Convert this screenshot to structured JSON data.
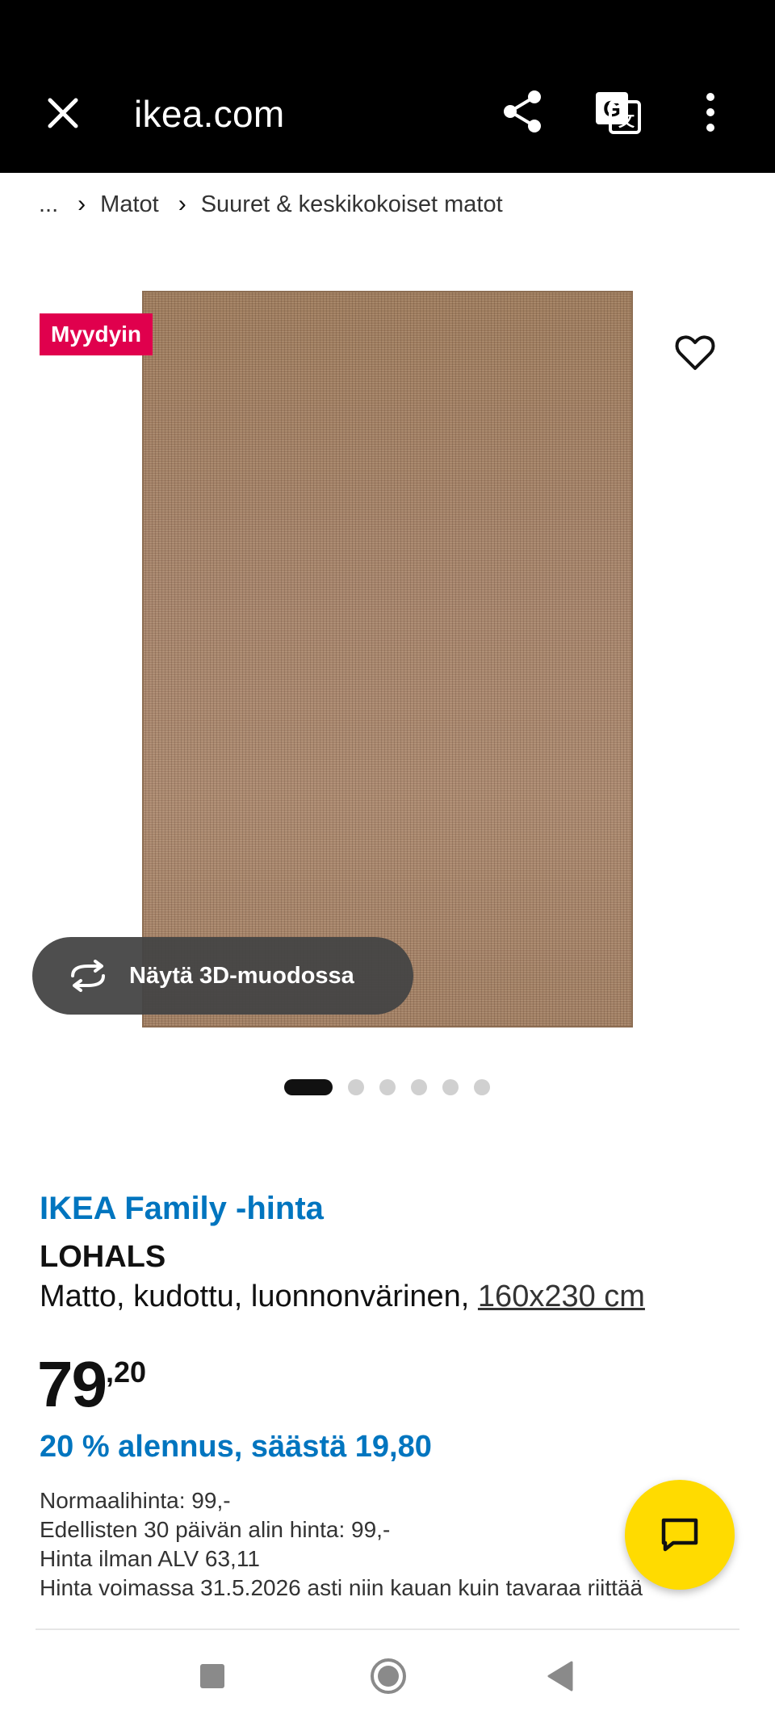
{
  "browser": {
    "domain": "ikea.com",
    "icons": [
      "close-icon",
      "share-icon",
      "translate-icon",
      "more-vert-icon"
    ]
  },
  "breadcrumb": [
    "...",
    "Matot",
    "Suuret & keskikokoiset matot"
  ],
  "gallery": {
    "badge": "Myydyin",
    "view_3d_label": "Näytä 3D-muodossa",
    "image_count": 6,
    "active_index": 0
  },
  "product": {
    "family_price_label": "IKEA Family -hinta",
    "name": "LOHALS",
    "description": "Matto, kudottu, luonnonvärinen,",
    "size_link": "160x230 cm",
    "price_int": "79",
    "price_dec": ",20",
    "discount": "20 % alennus, säästä 19,80",
    "details": [
      "Normaalihinta: 99,-",
      "Edellisten 30 päivän alin hinta: 99,-",
      "Hinta ilman ALV 63,11",
      "Hinta voimassa 31.5.2026 asti niin kauan kuin tavaraa riittää"
    ]
  },
  "colors": {
    "family_blue": "#0075bf",
    "badge_red": "#e0004d",
    "chat_yellow": "#ffdb00"
  }
}
